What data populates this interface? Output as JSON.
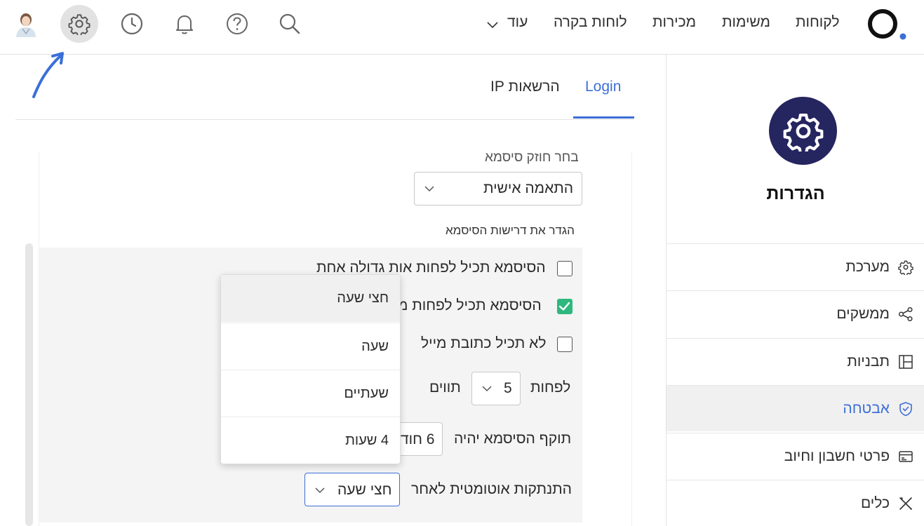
{
  "header": {
    "nav": [
      "לקוחות",
      "משימות",
      "מכירות",
      "לוחות בקרה",
      "עוד"
    ],
    "icons": [
      "search-icon",
      "help-icon",
      "bell-icon",
      "clock-icon",
      "gear-icon",
      "avatar"
    ]
  },
  "tabs": [
    {
      "label": "Login",
      "active": true
    },
    {
      "label": "הרשאות IP",
      "active": false
    }
  ],
  "sidebar": {
    "title": "הגדרות",
    "items": [
      {
        "label": "מערכת",
        "icon": "gear-icon",
        "active": false
      },
      {
        "label": "ממשקים",
        "icon": "share-icon",
        "active": false
      },
      {
        "label": "תבניות",
        "icon": "template-icon",
        "active": false
      },
      {
        "label": "אבטחה",
        "icon": "shield-icon",
        "active": true
      },
      {
        "label": "פרטי חשבון וחיוב",
        "icon": "billing-icon",
        "active": false
      },
      {
        "label": "כלים",
        "icon": "tools-icon",
        "active": false
      }
    ]
  },
  "form": {
    "strength_label": "בחר חוזק סיסמא",
    "strength_value": "התאמה אישית",
    "requirements_label": "הגדר את דרישות הסיסמא",
    "req_uppercase": "הסיסמא תכיל לפחות אות גדולה אחת",
    "req_second": "הסיסמא תכיל לפחות מ",
    "req_no_email": "לא תכיל כתובת מייל",
    "min_prefix": "לפחות",
    "min_value": "5",
    "min_suffix": "תווים",
    "expiry_label": "תוקף הסיסמא יהיה",
    "expiry_value": "6 חוד",
    "autologout_label": "התנתקות אוטומטית לאחר",
    "autologout_value": "חצי שעה",
    "checkboxes": {
      "uppercase": false,
      "second": true,
      "no_email": false
    }
  },
  "dropdown": {
    "options": [
      "חצי שעה",
      "שעה",
      "שעתיים",
      "4 שעות"
    ],
    "highlighted": "חצי שעה"
  },
  "colors": {
    "accent": "#3d6fd6",
    "brand_dark": "#252560",
    "check": "#2eb87e",
    "arrow": "#3a6fd8"
  }
}
